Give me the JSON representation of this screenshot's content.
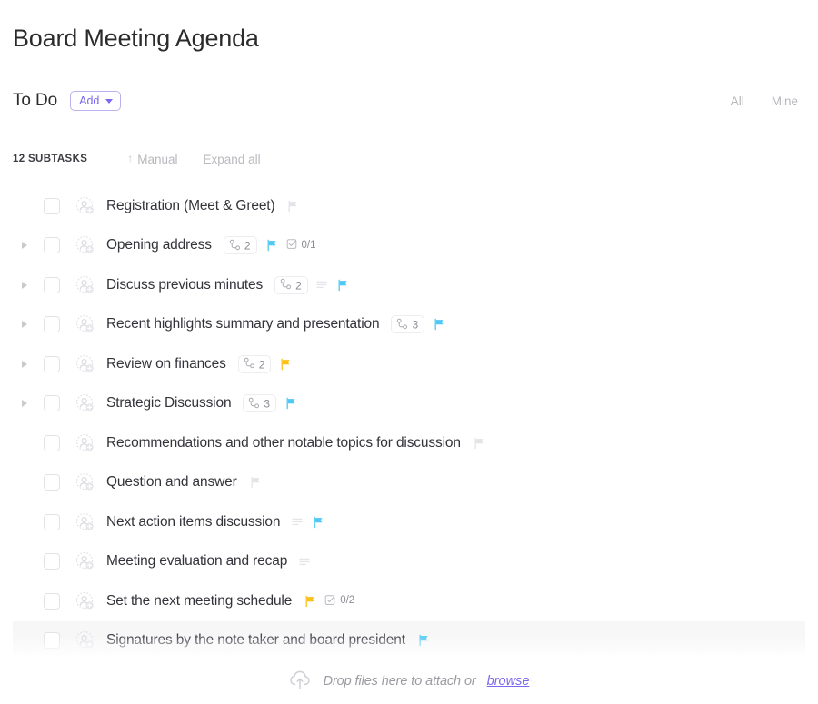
{
  "header": {
    "title": "Board Meeting Agenda"
  },
  "status_section": {
    "status_label": "To Do",
    "add_label": "Add",
    "filters": [
      {
        "label": "All"
      },
      {
        "label": "Mine"
      }
    ]
  },
  "subtasks_toolbar": {
    "count_label": "12 SUBTASKS",
    "sort_label": "Manual",
    "sort_icon": "arrow-up-icon",
    "expand_label": "Expand all"
  },
  "colors": {
    "accent_purple": "#7b68ee",
    "flag_cyan": "#4fc8f5",
    "flag_yellow": "#fcc017",
    "flag_gray": "#e4e4e8",
    "text_primary": "#33333a",
    "text_muted": "#b9b9be"
  },
  "tasks": [
    {
      "name": "Registration (Meet & Greet)",
      "expandable": false,
      "subtask_count": null,
      "has_description": false,
      "flag": "gray",
      "checklist": null
    },
    {
      "name": "Opening address",
      "expandable": true,
      "subtask_count": "2",
      "has_description": false,
      "flag": "cyan",
      "checklist": "0/1"
    },
    {
      "name": "Discuss previous minutes",
      "expandable": true,
      "subtask_count": "2",
      "has_description": true,
      "flag": "cyan",
      "checklist": null
    },
    {
      "name": "Recent highlights summary and presentation",
      "expandable": true,
      "subtask_count": "3",
      "has_description": false,
      "flag": "cyan",
      "checklist": null
    },
    {
      "name": "Review on finances",
      "expandable": true,
      "subtask_count": "2",
      "has_description": false,
      "flag": "yellow",
      "checklist": null
    },
    {
      "name": "Strategic Discussion",
      "expandable": true,
      "subtask_count": "3",
      "has_description": false,
      "flag": "cyan",
      "checklist": null
    },
    {
      "name": "Recommendations and other notable topics for discussion",
      "expandable": false,
      "subtask_count": null,
      "has_description": false,
      "flag": "gray",
      "checklist": null
    },
    {
      "name": "Question and answer",
      "expandable": false,
      "subtask_count": null,
      "has_description": false,
      "flag": "gray",
      "checklist": null
    },
    {
      "name": "Next action items discussion",
      "expandable": false,
      "subtask_count": null,
      "has_description": true,
      "flag": "cyan",
      "checklist": null
    },
    {
      "name": "Meeting evaluation and recap",
      "expandable": false,
      "subtask_count": null,
      "has_description": true,
      "flag": null,
      "checklist": null
    },
    {
      "name": "Set the next meeting schedule",
      "expandable": false,
      "subtask_count": null,
      "has_description": false,
      "flag": "yellow",
      "checklist": "0/2"
    },
    {
      "name": "Signatures by the note taker and board president",
      "expandable": false,
      "subtask_count": null,
      "has_description": false,
      "flag": "cyan",
      "checklist": null,
      "hovered": true
    }
  ],
  "footer": {
    "drop_text": "Drop files here to attach or",
    "browse_label": "browse",
    "upload_icon": "cloud-upload-icon"
  }
}
